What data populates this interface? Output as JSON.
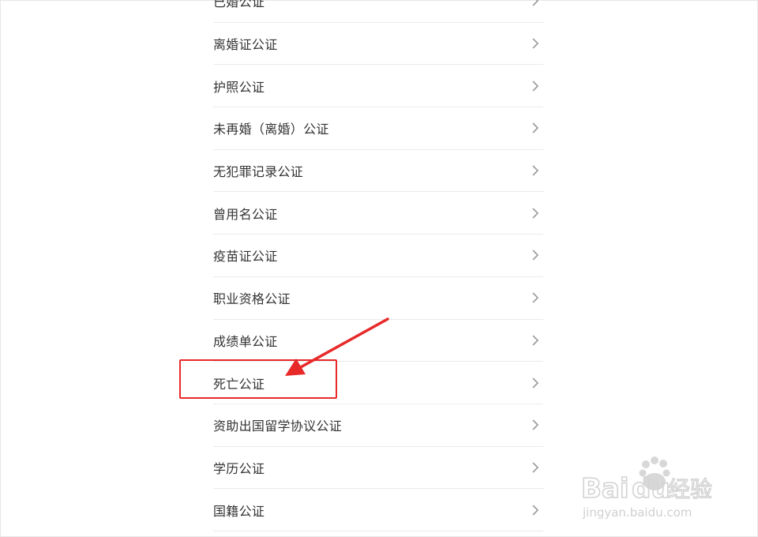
{
  "items": [
    {
      "label": "已婚公证"
    },
    {
      "label": "离婚证公证"
    },
    {
      "label": "护照公证"
    },
    {
      "label": "未再婚（离婚）公证"
    },
    {
      "label": "无犯罪记录公证"
    },
    {
      "label": "曾用名公证"
    },
    {
      "label": "疫苗证公证"
    },
    {
      "label": "职业资格公证"
    },
    {
      "label": "成绩单公证"
    },
    {
      "label": "死亡公证"
    },
    {
      "label": "资助出国留学协议公证"
    },
    {
      "label": "学历公证"
    },
    {
      "label": "国籍公证"
    }
  ],
  "annotation": {
    "color": "#e8292a",
    "highlighted_item": "死亡公证"
  },
  "watermark": {
    "brand": "Baidu经验",
    "url": "jingyan.baidu.com"
  }
}
